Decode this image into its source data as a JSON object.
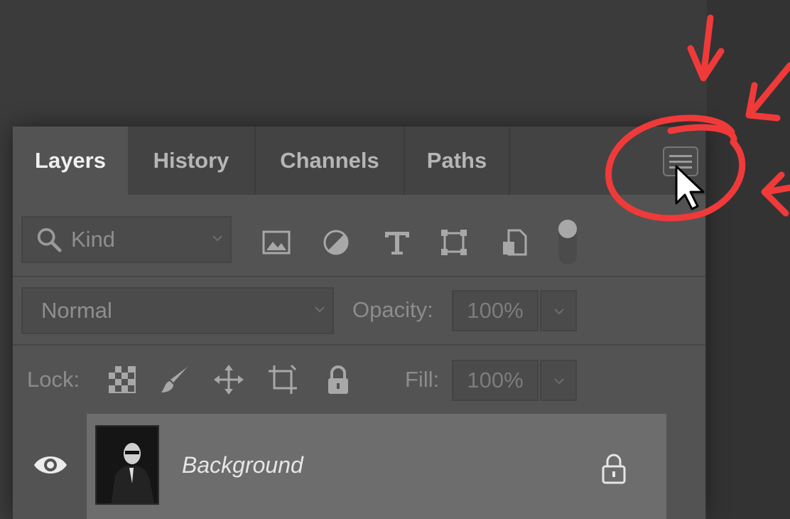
{
  "tabs": [
    {
      "label": "Layers",
      "active": true
    },
    {
      "label": "History",
      "active": false
    },
    {
      "label": "Channels",
      "active": false
    },
    {
      "label": "Paths",
      "active": false
    }
  ],
  "filter": {
    "kind_label": "Kind",
    "icons": [
      "image-filter-icon",
      "adjustment-filter-icon",
      "type-filter-icon",
      "shape-filter-icon",
      "smart-object-filter-icon",
      "filter-toggle-icon"
    ]
  },
  "blend": {
    "mode": "Normal",
    "opacity_label": "Opacity:",
    "opacity_value": "100%"
  },
  "lock": {
    "label": "Lock:",
    "fill_label": "Fill:",
    "fill_value": "100%",
    "icons": [
      "lock-transparent-pixels-icon",
      "lock-image-pixels-icon",
      "lock-position-icon",
      "lock-artboard-icon",
      "lock-all-icon"
    ]
  },
  "layers": [
    {
      "name": "Background",
      "visible": true,
      "locked": true
    }
  ],
  "colors": {
    "annotation": "#f03a3a",
    "panel_bg": "#535353",
    "selected_layer": "#6d6d6d"
  }
}
